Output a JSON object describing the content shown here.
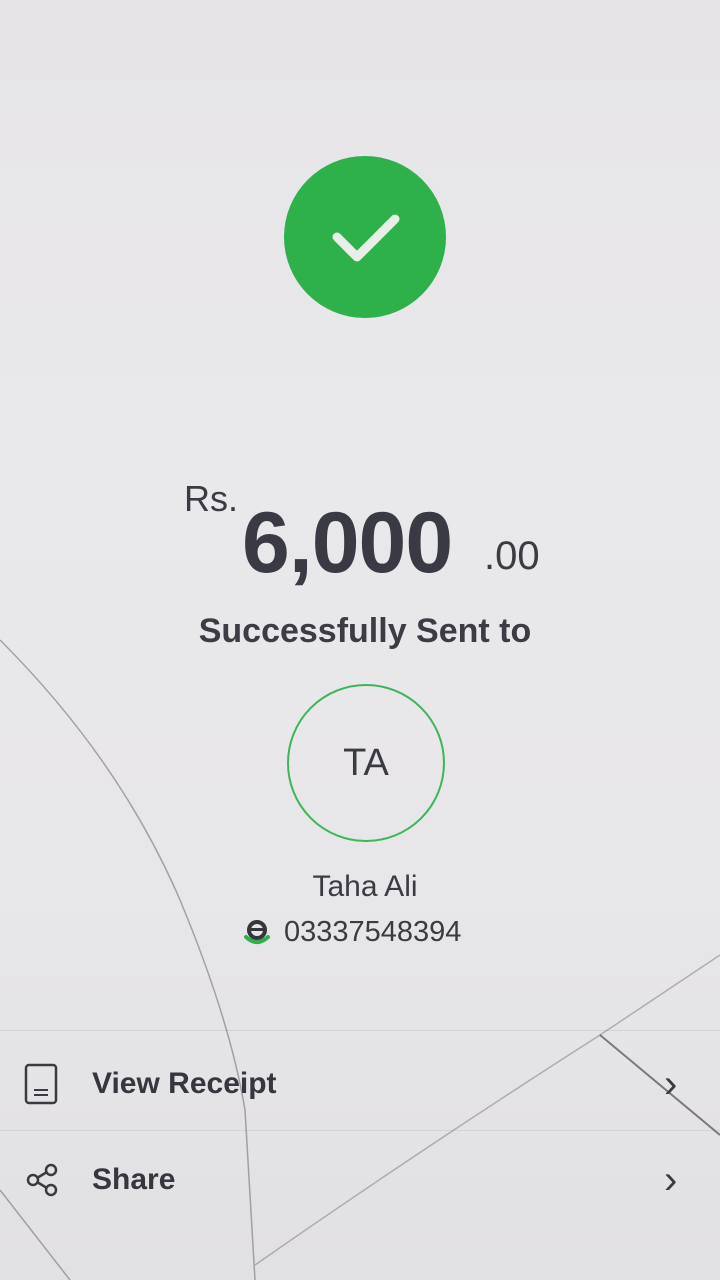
{
  "status": {
    "icon": "checkmark-circle-icon",
    "color": "#2eb04b"
  },
  "amount": {
    "currency": "Rs.",
    "whole": "6,000",
    "decimal": ".00"
  },
  "message": "Successfully Sent to",
  "recipient": {
    "initials": "TA",
    "name": "Taha Ali",
    "phone": "03337548394",
    "wallet_icon": "easypaisa-wallet-icon"
  },
  "actions": [
    {
      "label": "View Receipt",
      "icon": "receipt-icon"
    },
    {
      "label": "Share",
      "icon": "share-icon"
    }
  ],
  "colors": {
    "accent": "#2eb04b",
    "text": "#3a3a44",
    "background": "#e8e7e9"
  }
}
